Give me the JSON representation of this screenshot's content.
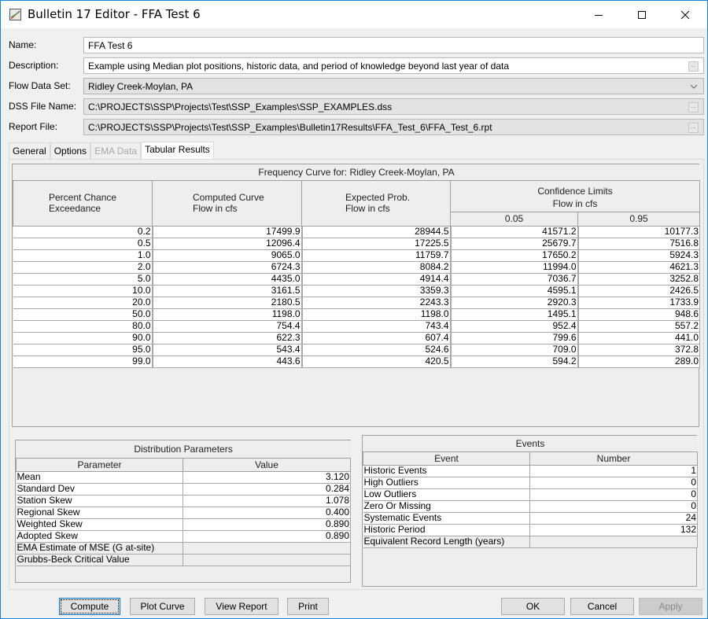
{
  "window": {
    "title": "Bulletin 17 Editor - FFA Test 6",
    "icon": "chart-icon",
    "controls": {
      "minimize": "minimize-icon",
      "maximize": "maximize-icon",
      "close": "close-icon"
    }
  },
  "fields": {
    "name": {
      "label": "Name:",
      "value": "FFA Test 6"
    },
    "description": {
      "label": "Description:",
      "value": "Example using Median plot positions, historic data, and period of knowledge beyond last year of data",
      "browse": "..."
    },
    "flow_data_set": {
      "label": "Flow Data Set:",
      "value": "Ridley Creek-Moylan, PA"
    },
    "dss_file_name": {
      "label": "DSS File Name:",
      "value": "C:\\PROJECTS\\SSP\\Projects\\Test\\SSP_Examples\\SSP_EXAMPLES.dss",
      "browse": "..."
    },
    "report_file": {
      "label": "Report File:",
      "value": "C:\\PROJECTS\\SSP\\Projects\\Test\\SSP_Examples\\Bulletin17Results\\FFA_Test_6\\FFA_Test_6.rpt",
      "browse": "..."
    }
  },
  "tabs": [
    {
      "label": "General",
      "state": "normal"
    },
    {
      "label": "Options",
      "state": "normal"
    },
    {
      "label": "EMA Data",
      "state": "disabled"
    },
    {
      "label": "Tabular Results",
      "state": "active"
    }
  ],
  "frequency_table": {
    "caption": "Frequency Curve for: Ridley Creek-Moylan, PA",
    "headers": {
      "pce": [
        "Percent Chance",
        "Exceedance"
      ],
      "computed": [
        "Computed Curve",
        "Flow in cfs"
      ],
      "expected": [
        "Expected Prob.",
        "Flow in cfs"
      ],
      "confidence": [
        "Confidence Limits",
        "Flow in cfs"
      ],
      "cl_low": "0.05",
      "cl_high": "0.95"
    },
    "rows": [
      [
        "0.2",
        "17499.9",
        "28944.5",
        "41571.2",
        "10177.3"
      ],
      [
        "0.5",
        "12096.4",
        "17225.5",
        "25679.7",
        "7516.8"
      ],
      [
        "1.0",
        "9065.0",
        "11759.7",
        "17650.2",
        "5924.3"
      ],
      [
        "2.0",
        "6724.3",
        "8084.2",
        "11994.0",
        "4621.3"
      ],
      [
        "5.0",
        "4435.0",
        "4914.4",
        "7036.7",
        "3252.8"
      ],
      [
        "10.0",
        "3161.5",
        "3359.3",
        "4595.1",
        "2426.5"
      ],
      [
        "20.0",
        "2180.5",
        "2243.3",
        "2920.3",
        "1733.9"
      ],
      [
        "50.0",
        "1198.0",
        "1198.0",
        "1495.1",
        "948.6"
      ],
      [
        "80.0",
        "754.4",
        "743.4",
        "952.4",
        "557.2"
      ],
      [
        "90.0",
        "622.3",
        "607.4",
        "799.6",
        "441.0"
      ],
      [
        "95.0",
        "543.4",
        "524.6",
        "709.0",
        "372.8"
      ],
      [
        "99.0",
        "443.6",
        "420.5",
        "594.2",
        "289.0"
      ]
    ]
  },
  "distribution_parameters": {
    "caption": "Distribution Parameters",
    "headers": [
      "Parameter",
      "Value"
    ],
    "rows": [
      [
        "Mean",
        "3.120"
      ],
      [
        "Standard Dev",
        "0.284"
      ],
      [
        "Station Skew",
        "1.078"
      ],
      [
        "Regional Skew",
        "0.400"
      ],
      [
        "Weighted Skew",
        "0.890"
      ],
      [
        "Adopted Skew",
        "0.890"
      ],
      [
        "EMA Estimate of MSE (G at-site)",
        ""
      ],
      [
        "Grubbs-Beck Critical Value",
        ""
      ]
    ]
  },
  "events": {
    "caption": "Events",
    "headers": [
      "Event",
      "Number"
    ],
    "rows": [
      [
        "Historic Events",
        "1"
      ],
      [
        "High Outliers",
        "0"
      ],
      [
        "Low Outliers",
        "0"
      ],
      [
        "Zero Or Missing",
        "0"
      ],
      [
        "Systematic Events",
        "24"
      ],
      [
        "Historic Period",
        "132"
      ],
      [
        "Equivalent Record Length (years)",
        ""
      ]
    ]
  },
  "buttons": {
    "compute": "Compute",
    "plot_curve": "Plot Curve",
    "view_report": "View Report",
    "print": "Print",
    "ok": "OK",
    "cancel": "Cancel",
    "apply": "Apply"
  }
}
